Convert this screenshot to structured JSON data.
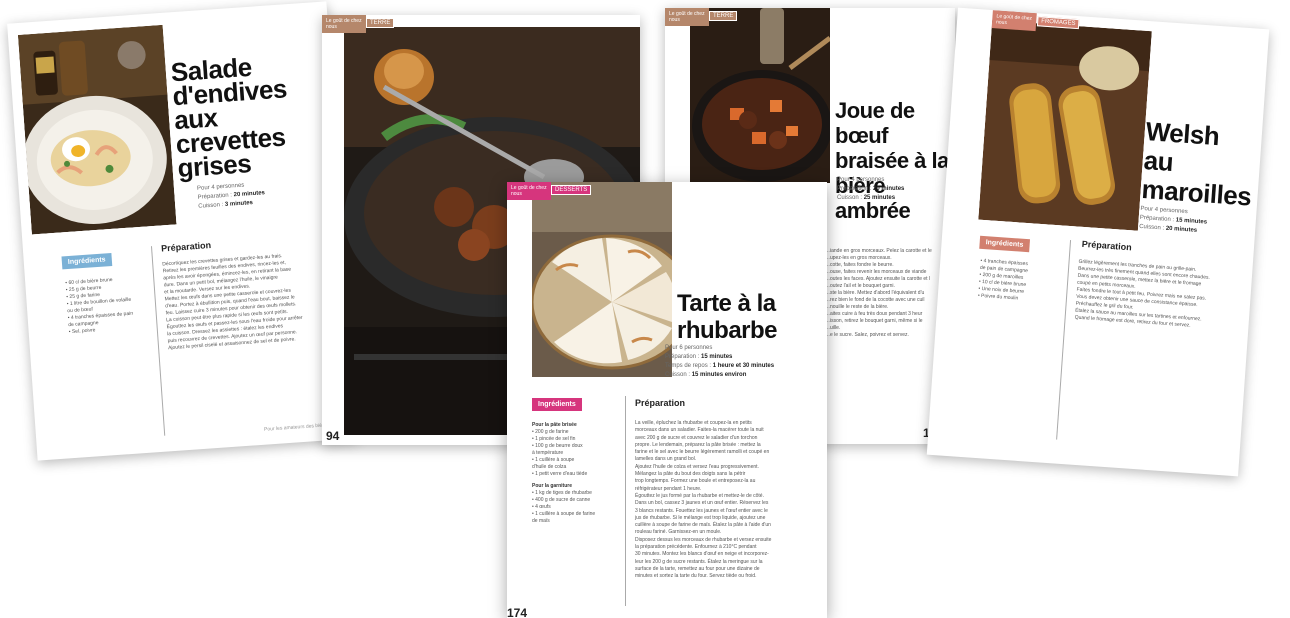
{
  "pages": {
    "salade": {
      "title_lines": [
        "Salade",
        "d'endives",
        "aux",
        "crevettes",
        "grises"
      ],
      "servings": "Pour 4 personnes",
      "prep_label": "Préparation : ",
      "prep_value": "20 minutes",
      "cook_label": "Cuisson : ",
      "cook_value": "3 minutes",
      "ingredients_tag": "Ingrédients",
      "ingredients": [
        "• 60 cl de bière brune",
        "• 25 g de beurre",
        "• 25 g de farine",
        "• 1 litre de bouillon de volaille",
        "  ou de bœuf",
        "• 4 tranches épaisses de pain",
        "  de campagne",
        "• Sel, poivre"
      ],
      "prep_heading": "Préparation",
      "steps": [
        "Décortiquez les crevettes grises et gardez-les au frais.",
        "Retirez les premières feuilles des endives, rincez-les et,",
        "après les avoir épongées, émincez-les, en retirant la base",
        "dure. Dans un petit bol, mélangez l'huile, le vinaigre",
        "et la moutarde. Versez sur les endives.",
        "Mettez les œufs dans une petite casserole et couvrez-les",
        "d'eau. Portez à ébullition puis, quand l'eau bout, baissez le",
        "feu. Laissez cuire 3 minutes pour obtenir des œufs mollets.",
        "La cuisson peut être plus rapide si les œufs sont petits.",
        "Égouttez les œufs et passez-les sous l'eau froide pour arrêter",
        "la cuisson. Dressez les assiettes : étalez les endives",
        "puis recouvrez de crevettes. Ajoutez un œuf par personne.",
        "Ajoutez le persil ciselé et assaisonnez de sel et de poivre."
      ],
      "footer": "Pour les amateurs des bières"
    },
    "pot": {
      "ribbon": "Le goût de chez nous",
      "category": "TERRE",
      "page_number": "94"
    },
    "joue": {
      "ribbon": "Le goût de chez nous",
      "category": "TERRE",
      "title_lines": [
        "Joue de bœuf",
        "braisée à la",
        "bière ambrée"
      ],
      "servings": "Pour 4 personnes",
      "prep_label": "Préparation : ",
      "prep_value": "20 minutes",
      "cook_label": "Cuisson : ",
      "cook_value": "25 minutes",
      "steps": [
        "…iande en gros morceaux. Pelez la carotte et le",
        "…upez-les en gros morceaux.",
        "…cotte, faites fondre le beurre.",
        "…ouse, faites revenir les morceaux de viande",
        "…outes les faces. Ajoutez ensuite la carotte et l",
        "…outez l'ail et le bouquet garni.",
        "…ste la bière. Mettez d'abord l'équivalent d'u",
        "…rez bien le fond de la cocotte avec une cuil",
        "…nouille le reste de la bière.",
        "…aites cuire à feu très doux pendant 3 heur",
        "…isson, retirez le bouquet garni, même si le",
        "…uille.",
        "…e le sucre. Salez, poivrez et servez."
      ],
      "page_number": "138"
    },
    "welsh": {
      "ribbon": "Le goût de chez nous",
      "category": "FROMAGES",
      "title_lines": [
        "Welsh",
        "au",
        "maroilles"
      ],
      "servings": "Pour 4 personnes",
      "prep_label": "Préparation : ",
      "prep_value": "15 minutes",
      "cook_label": "Cuisson : ",
      "cook_value": "20 minutes",
      "ingredients_tag": "Ingrédients",
      "ingredients": [
        "• 4 tranches épaisses",
        "  de pain de campagne",
        "• 200 g de maroilles",
        "• 10 cl de bière brune",
        "• Une noix de beurre",
        "• Poivre du moulin"
      ],
      "prep_heading": "Préparation",
      "steps": [
        "Grillez légèrement les tranches de pain ou grille-pain.",
        "Beurrez-les très finement quand elles sont encore chaudes.",
        "Dans une petite casserole, mettez la bière et le fromage",
        "coupé en petits morceaux.",
        "Faites fondre le tout à petit feu. Poivrez mais ne salez pas.",
        "Vous devez obtenir une sauce de consistance épaisse.",
        "Préchauffez le gril du four.",
        "Étalez la sauce au maroilles sur les tartines et enfournez.",
        "Quand le fromage est doré, retirez du four et servez."
      ]
    },
    "tarte": {
      "ribbon": "Le goût de chez nous",
      "category": "DESSERTS",
      "title_lines": [
        "Tarte à la",
        "rhubarbe"
      ],
      "servings": "Pour 6 personnes",
      "prep_label": "Préparation : ",
      "prep_value": "15 minutes",
      "rest_label": "Temps de repos : ",
      "rest_value": "1 heure et 30 minutes",
      "cook_label": "Cuisson : ",
      "cook_value": "15 minutes environ",
      "ingredients_tag": "Ingrédients",
      "pate_heading": "Pour la pâte brisée",
      "pate": [
        "• 200 g de farine",
        "• 1 pincée de sel fin",
        "• 100 g de beurre doux",
        "  à température",
        "• 1 cuillère à soupe",
        "  d'huile de colza",
        "• 1 petit verre d'eau tiède"
      ],
      "garniture_heading": "Pour la garniture",
      "garniture": [
        "• 1 kg de tiges de rhubarbe",
        "• 400 g de sucre de canne",
        "• 4 œufs",
        "• 1 cuillère à soupe de farine",
        "  de maïs"
      ],
      "prep_heading": "Préparation",
      "steps": [
        "La veille, épluchez la rhubarbe et coupez-la en petits",
        "morceaux dans un saladier. Faites-la macérer toute la nuit",
        "avec 200 g de sucre et couvrez le saladier d'un torchon",
        "propre. Le lendemain, préparez la pâte brisée : mettez la",
        "farine et le sel avec le beurre légèrement ramolli et coupé en",
        "lamelles dans un grand bol.",
        "Ajoutez l'huile de colza et versez l'eau progressivement.",
        "Mélangez la pâte du bout des doigts sans la pétrir",
        "trop longtemps. Formez une boule et entreposez-la au",
        "réfrigérateur pendant 1 heure.",
        "Égouttez le jus formé par la rhubarbe et mettez-le de côté.",
        "Dans un bol, cassez 3 jaunes et un œuf entier. Réservez les",
        "3 blancs restants. Fouettez les jaunes et l'œuf entier avec le",
        "jus de rhubarbe. Si le mélange est trop liquide, ajoutez une",
        "cuillère à soupe de farine de maïs. Étalez la pâte à l'aide d'un",
        "rouleau fariné. Garnissez-en un moule.",
        "Disposez dessus les morceaux de rhubarbe et versez ensuite",
        "la préparation précédente. Enfournez à 210°C pendant",
        "30 minutes. Montez les blancs d'œuf en neige et incorporez-",
        "leur les 200 g de sucre restants. Étalez la meringue sur la",
        "surface de la tarte, remettez au four pour une dizaine de",
        "minutes et sortez la tarte du four. Servez tiède ou froid."
      ],
      "page_number": "174"
    }
  },
  "colors": {
    "terre": "#b5876b",
    "desserts": "#d6357d",
    "fromages": "#d2806f",
    "ingredients_blue": "#7bb1d6"
  }
}
